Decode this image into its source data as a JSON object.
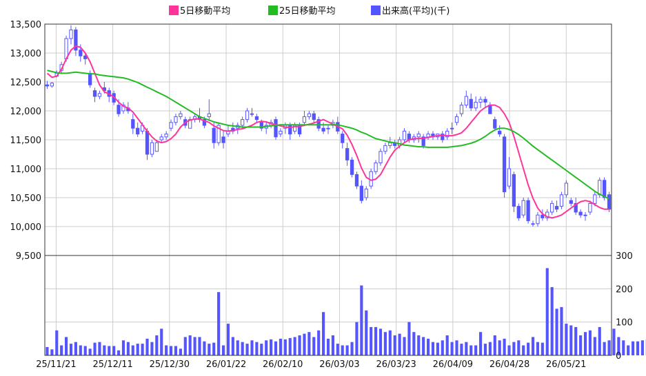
{
  "legend": {
    "ma5": "5日移動平均",
    "ma25": "25日移動平均",
    "volume": "出来高(平均)(千)"
  },
  "colors": {
    "ma5": "#ff3399",
    "ma25": "#22bb22",
    "volume": "#5555ff",
    "candle_up_fill": "#ffffff",
    "candle_down_fill": "#5555ff",
    "candle_outline": "#5555ff",
    "grid": "#cccccc"
  },
  "chart_data": [
    {
      "type": "candlestick",
      "title": "",
      "ylim": [
        9500,
        13500
      ],
      "y_ticks": [
        "9,500",
        "10,000",
        "10,500",
        "11,000",
        "11,500",
        "12,000",
        "12,500",
        "13,000",
        "13,500"
      ],
      "x_tick_labels": [
        "25/11/21",
        "25/12/11",
        "25/12/30",
        "26/01/22",
        "26/02/10",
        "26/03/03",
        "26/03/23",
        "26/04/09",
        "26/04/28",
        "26/05/21"
      ],
      "candles": [
        [
          12450,
          12520,
          12380,
          12430
        ],
        [
          12430,
          12500,
          12400,
          12480
        ],
        [
          12600,
          12700,
          12580,
          12650
        ],
        [
          12700,
          12850,
          12650,
          12800
        ],
        [
          12900,
          13300,
          12850,
          13250
        ],
        [
          13250,
          13480,
          13150,
          13400
        ],
        [
          13400,
          13450,
          12950,
          13050
        ],
        [
          13050,
          13150,
          12850,
          12950
        ],
        [
          12950,
          13000,
          12800,
          12900
        ],
        [
          12650,
          12700,
          12400,
          12450
        ],
        [
          12350,
          12400,
          12150,
          12250
        ],
        [
          12250,
          12350,
          12200,
          12300
        ],
        [
          12400,
          12500,
          12300,
          12350
        ],
        [
          12350,
          12400,
          12150,
          12250
        ],
        [
          12300,
          12350,
          12100,
          12150
        ],
        [
          12100,
          12200,
          11900,
          11950
        ],
        [
          12000,
          12150,
          11950,
          12100
        ],
        [
          12050,
          12150,
          11950,
          12000
        ],
        [
          11850,
          11950,
          11600,
          11700
        ],
        [
          11700,
          11800,
          11550,
          11600
        ],
        [
          11650,
          11800,
          11600,
          11750
        ],
        [
          11650,
          11700,
          11150,
          11250
        ],
        [
          11250,
          11500,
          11200,
          11450
        ],
        [
          11300,
          11500,
          11300,
          11450
        ],
        [
          11500,
          11600,
          11450,
          11550
        ],
        [
          11550,
          11650,
          11500,
          11600
        ],
        [
          11700,
          11850,
          11650,
          11800
        ],
        [
          11800,
          11950,
          11750,
          11900
        ],
        [
          11900,
          12000,
          11850,
          11950
        ],
        [
          11850,
          11900,
          11700,
          11750
        ],
        [
          11700,
          11900,
          11700,
          11850
        ],
        [
          11850,
          11950,
          11800,
          11900
        ],
        [
          11900,
          12050,
          11800,
          11850
        ],
        [
          11850,
          11900,
          11700,
          11750
        ],
        [
          11900,
          12200,
          11850,
          11950
        ],
        [
          11700,
          11800,
          11350,
          11450
        ],
        [
          11450,
          11800,
          11400,
          11750
        ],
        [
          11550,
          11650,
          11350,
          11450
        ],
        [
          11600,
          11750,
          11550,
          11650
        ],
        [
          11700,
          11800,
          11600,
          11650
        ],
        [
          11700,
          11800,
          11600,
          11750
        ],
        [
          11750,
          11900,
          11700,
          11850
        ],
        [
          11850,
          12050,
          11800,
          12000
        ],
        [
          11950,
          12050,
          11900,
          11950
        ],
        [
          11900,
          11950,
          11800,
          11850
        ],
        [
          11800,
          11850,
          11650,
          11700
        ],
        [
          11700,
          11800,
          11600,
          11750
        ],
        [
          11750,
          11850,
          11700,
          11800
        ],
        [
          11850,
          11900,
          11500,
          11550
        ],
        [
          11600,
          11700,
          11550,
          11650
        ],
        [
          11700,
          11800,
          11600,
          11750
        ],
        [
          11750,
          11800,
          11500,
          11600
        ],
        [
          11650,
          11800,
          11600,
          11750
        ],
        [
          11750,
          11800,
          11550,
          11600
        ],
        [
          11800,
          12000,
          11750,
          11900
        ],
        [
          11900,
          12000,
          11850,
          11950
        ],
        [
          11950,
          12000,
          11800,
          11850
        ],
        [
          11850,
          11900,
          11650,
          11700
        ],
        [
          11700,
          11800,
          11600,
          11650
        ],
        [
          11700,
          11750,
          11600,
          11700
        ],
        [
          11750,
          11850,
          11700,
          11800
        ],
        [
          11800,
          11900,
          11600,
          11650
        ],
        [
          11600,
          11650,
          11350,
          11450
        ],
        [
          11350,
          11450,
          11050,
          11150
        ],
        [
          11150,
          11200,
          10850,
          10900
        ],
        [
          10900,
          10950,
          10650,
          10700
        ],
        [
          10700,
          10800,
          10400,
          10450
        ],
        [
          10500,
          10700,
          10450,
          10650
        ],
        [
          10700,
          11000,
          10650,
          10950
        ],
        [
          10950,
          11150,
          10900,
          11100
        ],
        [
          11100,
          11350,
          11050,
          11300
        ],
        [
          11300,
          11450,
          11250,
          11400
        ],
        [
          11400,
          11550,
          11350,
          11450
        ],
        [
          11450,
          11500,
          11350,
          11400
        ],
        [
          11400,
          11550,
          11350,
          11500
        ],
        [
          11500,
          11700,
          11450,
          11650
        ],
        [
          11600,
          11650,
          11450,
          11500
        ],
        [
          11500,
          11600,
          11450,
          11550
        ],
        [
          11550,
          11650,
          11450,
          11600
        ],
        [
          11550,
          11600,
          11350,
          11400
        ],
        [
          11550,
          11650,
          11500,
          11600
        ],
        [
          11600,
          11650,
          11500,
          11550
        ],
        [
          11550,
          11600,
          11500,
          11600
        ],
        [
          11600,
          11650,
          11450,
          11500
        ],
        [
          11550,
          11700,
          11500,
          11650
        ],
        [
          11700,
          11800,
          11600,
          11700
        ],
        [
          11800,
          11950,
          11750,
          11900
        ],
        [
          11950,
          12150,
          11900,
          12100
        ],
        [
          12100,
          12350,
          12050,
          12250
        ],
        [
          12200,
          12300,
          12000,
          12050
        ],
        [
          12050,
          12250,
          12000,
          12150
        ],
        [
          12150,
          12250,
          12050,
          12200
        ],
        [
          12200,
          12250,
          12050,
          12150
        ],
        [
          12100,
          12150,
          11950,
          11950
        ],
        [
          11850,
          11900,
          11650,
          11700
        ],
        [
          11650,
          11750,
          11550,
          11600
        ],
        [
          11550,
          11600,
          10500,
          10600
        ],
        [
          10700,
          11200,
          10650,
          11000
        ],
        [
          10900,
          10950,
          10250,
          10350
        ],
        [
          10350,
          10400,
          10100,
          10150
        ],
        [
          10200,
          10500,
          10150,
          10450
        ],
        [
          10450,
          10500,
          10050,
          10100
        ],
        [
          10050,
          10100,
          10000,
          10050
        ],
        [
          10050,
          10250,
          10000,
          10200
        ],
        [
          10200,
          10300,
          10100,
          10150
        ],
        [
          10150,
          10300,
          10100,
          10250
        ],
        [
          10250,
          10450,
          10200,
          10400
        ],
        [
          10350,
          10450,
          10250,
          10300
        ],
        [
          10350,
          10600,
          10300,
          10550
        ],
        [
          10550,
          10800,
          10500,
          10750
        ],
        [
          10450,
          10500,
          10350,
          10400
        ],
        [
          10400,
          10500,
          10200,
          10250
        ],
        [
          10250,
          10300,
          10150,
          10200
        ],
        [
          10200,
          10250,
          10100,
          10200
        ],
        [
          10250,
          10450,
          10200,
          10400
        ],
        [
          10400,
          10600,
          10350,
          10550
        ],
        [
          10550,
          10850,
          10500,
          10800
        ],
        [
          10800,
          10850,
          10450,
          10500
        ],
        [
          10550,
          10600,
          10250,
          10300
        ]
      ],
      "series": [
        {
          "name": "5日移動平均",
          "values": [
            12650,
            12580,
            12600,
            12720,
            12900,
            13050,
            13120,
            13100,
            13000,
            12850,
            12650,
            12450,
            12330,
            12290,
            12240,
            12150,
            12080,
            12050,
            11980,
            11870,
            11760,
            11650,
            11550,
            11480,
            11450,
            11470,
            11520,
            11600,
            11720,
            11800,
            11840,
            11860,
            11860,
            11830,
            11800,
            11740,
            11700,
            11660,
            11650,
            11660,
            11680,
            11690,
            11720,
            11750,
            11800,
            11820,
            11810,
            11780,
            11760,
            11740,
            11720,
            11710,
            11730,
            11730,
            11750,
            11770,
            11790,
            11820,
            11850,
            11810,
            11770,
            11730,
            11690,
            11580,
            11420,
            11230,
            11010,
            10850,
            10800,
            10820,
            10900,
            11050,
            11200,
            11320,
            11390,
            11450,
            11500,
            11520,
            11520,
            11530,
            11540,
            11560,
            11570,
            11580,
            11570,
            11570,
            11590,
            11620,
            11700,
            11800,
            11900,
            12000,
            12060,
            12100,
            12100,
            12060,
            11950,
            11800,
            11560,
            11280,
            11000,
            10720,
            10490,
            10320,
            10220,
            10170,
            10150,
            10170,
            10200,
            10260,
            10320,
            10380,
            10430,
            10450,
            10430,
            10380,
            10330,
            10300,
            10300,
            10330,
            10400,
            10480,
            10460
          ]
        },
        {
          "name": "25日移動平均",
          "values": [
            12700,
            12680,
            12660,
            12650,
            12650,
            12660,
            12670,
            12660,
            12650,
            12640,
            12640,
            12620,
            12610,
            12600,
            12590,
            12580,
            12570,
            12550,
            12520,
            12490,
            12450,
            12410,
            12370,
            12330,
            12290,
            12250,
            12200,
            12150,
            12100,
            12050,
            12000,
            11950,
            11900,
            11870,
            11840,
            11810,
            11790,
            11770,
            11750,
            11740,
            11730,
            11720,
            11720,
            11720,
            11720,
            11720,
            11730,
            11740,
            11750,
            11760,
            11760,
            11760,
            11760,
            11760,
            11760,
            11760,
            11760,
            11760,
            11760,
            11760,
            11760,
            11760,
            11740,
            11720,
            11700,
            11670,
            11630,
            11600,
            11560,
            11520,
            11500,
            11480,
            11460,
            11450,
            11430,
            11410,
            11400,
            11390,
            11380,
            11380,
            11370,
            11370,
            11370,
            11370,
            11370,
            11380,
            11390,
            11400,
            11420,
            11440,
            11470,
            11510,
            11560,
            11620,
            11670,
            11700,
            11700,
            11680,
            11640,
            11590,
            11530,
            11460,
            11390,
            11330,
            11270,
            11210,
            11150,
            11090,
            11030,
            10970,
            10910,
            10850,
            10790,
            10730,
            10670,
            10610,
            10560,
            10520,
            10480,
            10450,
            10450
          ]
        }
      ]
    },
    {
      "type": "bar",
      "name": "出来高(平均)(千)",
      "ylim": [
        0,
        300
      ],
      "y_ticks": [
        "0",
        "100",
        "200",
        "300"
      ],
      "values": [
        25,
        18,
        75,
        30,
        55,
        35,
        40,
        30,
        28,
        20,
        38,
        40,
        30,
        28,
        28,
        15,
        45,
        40,
        30,
        35,
        35,
        50,
        40,
        60,
        80,
        30,
        28,
        28,
        20,
        55,
        60,
        55,
        55,
        42,
        35,
        38,
        190,
        30,
        95,
        55,
        45,
        40,
        35,
        45,
        40,
        35,
        45,
        48,
        42,
        50,
        48,
        52,
        55,
        60,
        65,
        70,
        55,
        75,
        130,
        50,
        60,
        35,
        30,
        30,
        40,
        100,
        210,
        135,
        85,
        85,
        80,
        70,
        75,
        60,
        65,
        55,
        100,
        70,
        60,
        55,
        50,
        40,
        38,
        45,
        60,
        40,
        45,
        35,
        40,
        30,
        30,
        70,
        35,
        40,
        60,
        45,
        50,
        30,
        40,
        45,
        30,
        38,
        55,
        40,
        38,
        262,
        205,
        140,
        145,
        95,
        90,
        85,
        60,
        70,
        75,
        55,
        85,
        40,
        45,
        80,
        55,
        45,
        30,
        42,
        42,
        45,
        48,
        35,
        60,
        40,
        25
      ]
    }
  ]
}
